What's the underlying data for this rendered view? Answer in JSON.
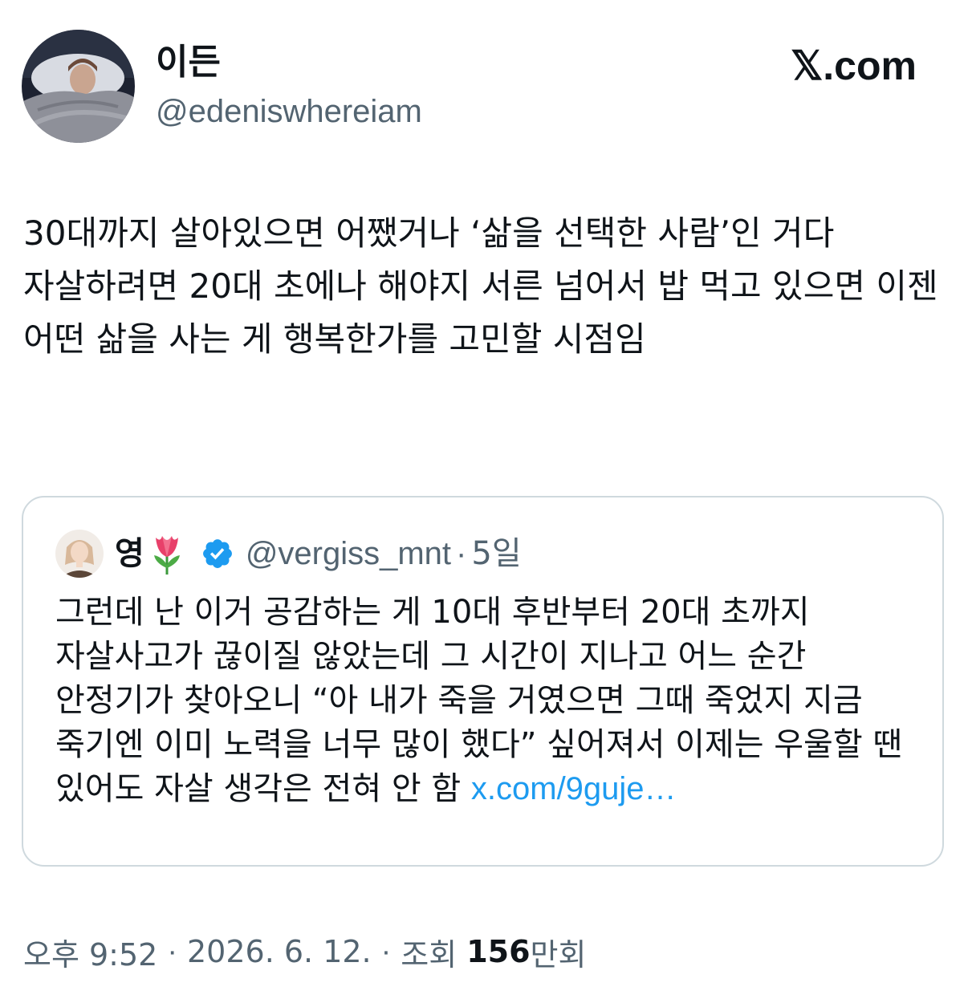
{
  "author": {
    "display_name": "이든",
    "handle": "@edeniswhereiam"
  },
  "brand": {
    "label": "𝕏.com",
    "icon": "x-logo"
  },
  "tweet": {
    "text": "30대까지 살아있으면 어쨌거나 ‘삶을 선택한 사람’인 거다 자살하려면 20대 초에나 해야지 서른 넘어서 밥 먹고 있으면 이젠 어떤 삶을 사는 게 행복한가를 고민할 시점임"
  },
  "quoted_tweet": {
    "display_name": "영",
    "name_emoji": "tulip-icon",
    "verified": true,
    "handle": "@vergiss_mnt",
    "separator": "·",
    "time": "5일",
    "text": "그런데 난 이거 공감하는 게 10대 후반부터 20대 초까지 자살사고가 끊이질 않았는데 그 시간이 지나고 어느 순간 안정기가 찾아오니 “아 내가 죽을 거였으면 그때 죽었지 지금 죽기엔 이미 노력을 너무 많이 했다” 싶어져서 이제는 우울할 땐 있어도 자살 생각은 전혀 안 함 ",
    "link": "x.com/9guje…"
  },
  "meta": {
    "time": "오후 9:52",
    "separator": "·",
    "date": "2026. 6. 12.",
    "views_label": "조회",
    "views_count": "156",
    "views_unit": "만회"
  },
  "colors": {
    "text_primary": "#0f1419",
    "text_secondary": "#536471",
    "link": "#1d9bf0",
    "border": "#cfd9de",
    "verified": "#1d9bf0"
  }
}
